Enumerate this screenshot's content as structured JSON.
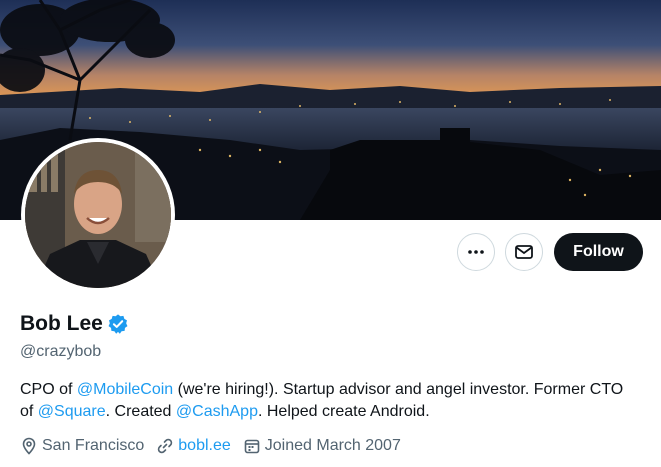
{
  "profile": {
    "display_name": "Bob Lee",
    "handle": "@crazybob",
    "verified": true,
    "verified_color": "#1d9bf0"
  },
  "actions": {
    "more_icon": "ellipsis-icon",
    "message_icon": "envelope-icon",
    "follow_label": "Follow"
  },
  "bio": {
    "segments": [
      {
        "text": "CPO of ",
        "link": false
      },
      {
        "text": "@MobileCoin",
        "link": true
      },
      {
        "text": " (we're hiring!). Startup advisor and angel investor. Former CTO of ",
        "link": false
      },
      {
        "text": "@Square",
        "link": true
      },
      {
        "text": ". Created ",
        "link": false
      },
      {
        "text": "@CashApp",
        "link": true
      },
      {
        "text": ". Helped create Android.",
        "link": false
      }
    ]
  },
  "meta": {
    "location": "San Francisco",
    "location_icon": "location-pin-icon",
    "website": "bobl.ee",
    "website_icon": "link-icon",
    "joined": "Joined March 2007",
    "joined_icon": "calendar-icon"
  },
  "colors": {
    "text_primary": "#0f1419",
    "text_secondary": "#536471",
    "accent": "#1d9bf0",
    "button_dark": "#0f1419"
  }
}
